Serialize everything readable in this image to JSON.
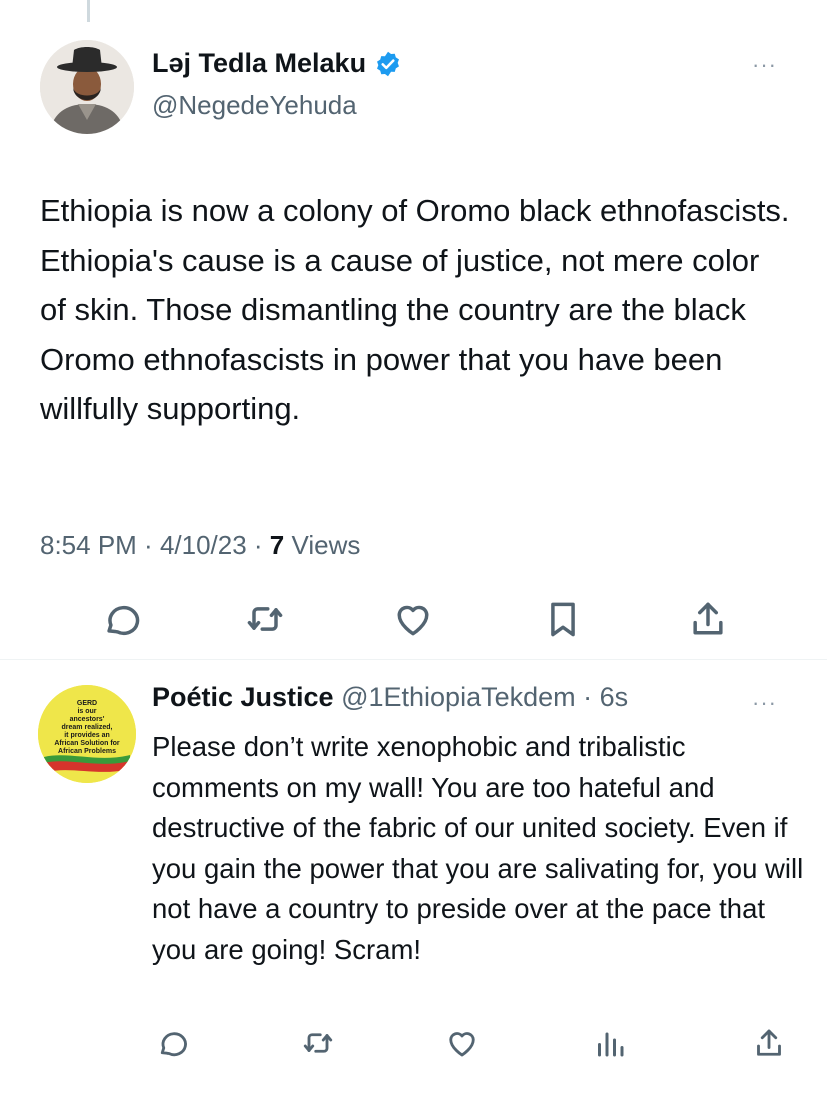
{
  "main_tweet": {
    "author_name": "Ləj Tedla Melaku",
    "handle": "@NegedeYehuda",
    "more": "···",
    "text": "Ethiopia is now a colony of Oromo black ethnofascists. Ethiopia's cause is a cause of justice, not mere color of skin. Those dismantling the country are the black Oromo ethnofascists in power that you have been willfully supporting.",
    "time": "8:54 PM",
    "date": "4/10/23",
    "views_count": "7",
    "views_label": "Views",
    "separator": " · ",
    "actions": [
      "reply-icon",
      "retweet-icon",
      "like-icon",
      "bookmark-icon",
      "share-icon"
    ]
  },
  "reply": {
    "author_name": "Poétic Justice",
    "handle": "@1EthiopiaTekdem",
    "separator": " · ",
    "time": "6s",
    "more": "···",
    "text": "Please don’t write xenophobic and tribalistic comments on my wall! You are too hateful and destructive of the fabric of our united society. Even if you gain the power that you are salivating for, you will not have a country to preside over at the pace that you are going! Scram!",
    "avatar_text": [
      "GERD",
      "is our",
      "ancestors'",
      "dream realized,",
      "it provides an",
      "African Solution for",
      "African Problems"
    ],
    "actions": [
      "reply-icon",
      "retweet-icon",
      "like-icon",
      "analytics-icon",
      "share-icon"
    ]
  },
  "colors": {
    "text": "#0f1419",
    "secondary": "#536471",
    "verified": "#1d9bf0",
    "avatar_reply_bg": "#f2e84a"
  }
}
